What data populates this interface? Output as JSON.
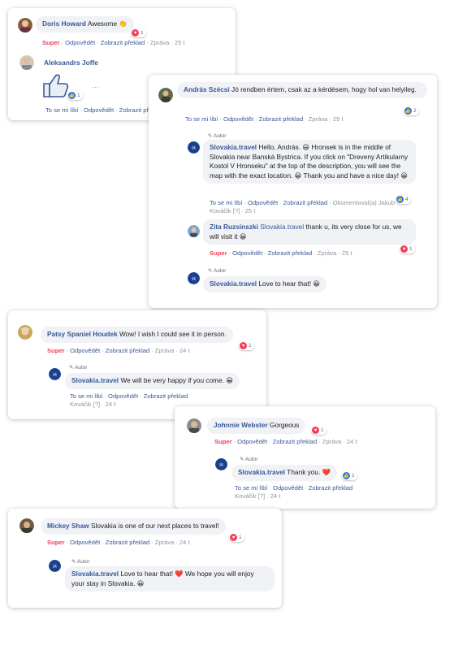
{
  "actions": {
    "super": "Super",
    "reply": "Odpovědět",
    "translate": "Zobrazit překlad",
    "message": "Zpráva",
    "like": "To se mi líbí",
    "edited_by": "Okomentoval(a) Jakub",
    "kovacik": "Kováčik",
    "q": "[?]"
  },
  "author_badge": "Autor",
  "comments": {
    "doris": {
      "name": "Doris Howard",
      "text": "Awesome",
      "emoji": "👏",
      "time": "25 t",
      "reactions": "1"
    },
    "aleksandrs": {
      "name": "Aleksandrs Joffe",
      "ellipsis": "···",
      "reactions": "1"
    },
    "andras": {
      "name": "András Szécsi",
      "text": "Jó rendben értem, csak az a kérdésem, hogy hol van helyileg.",
      "time": "25 t",
      "reactions": "2"
    },
    "sk1": {
      "name": "Slovakia.travel",
      "text": "Hello, András. 😃 Hronsek is in the middle of Slovakia near Banská Bystrica. If you click on \"Dreveny Artikularny Kostol V Hronseku\" at the top of the description, you will see the map with the exact location. 😀 Thank you and have a nice day! 😀",
      "time": "25 t",
      "reactions": "4"
    },
    "zita": {
      "name": "Zita Ruzsinszki",
      "mention": "Slovakia.travel",
      "text": "thank u, its very close for us, we will visit it 😀",
      "time": "25 t",
      "reactions": "1"
    },
    "sk2": {
      "name": "Slovakia.travel",
      "text": "Love to hear that! 😀"
    },
    "patsy": {
      "name": "Patsy Spaniel Houdek",
      "text": "Wow! I wish I could see it in person.",
      "time": "24 t",
      "reactions": "1"
    },
    "sk3": {
      "name": "Slovakia.travel",
      "text": "We will be very happy if you come. 😀",
      "time": "24 t"
    },
    "johnnie": {
      "name": "Johnnie Webster",
      "text": "Gorgeous",
      "time": "24 t",
      "reactions": "1"
    },
    "sk4": {
      "name": "Slovakia.travel",
      "text": "Thank you. ❤️",
      "time": "24 t",
      "reactions": "1"
    },
    "mickey": {
      "name": "Mickey Shaw",
      "text": "Slovakia is one of our next places to travel!",
      "time": "24 t",
      "reactions": "1"
    },
    "sk5": {
      "name": "Slovakia.travel",
      "text1": "Love to hear that!",
      "heart": "❤️",
      "text2": "We hope you will enjoy your stay in Slovakia. 😀"
    }
  },
  "colors": {
    "link": "#385898",
    "super": "#f33e58",
    "like_blue": "#1877f2",
    "bubble": "#f0f2f5"
  }
}
